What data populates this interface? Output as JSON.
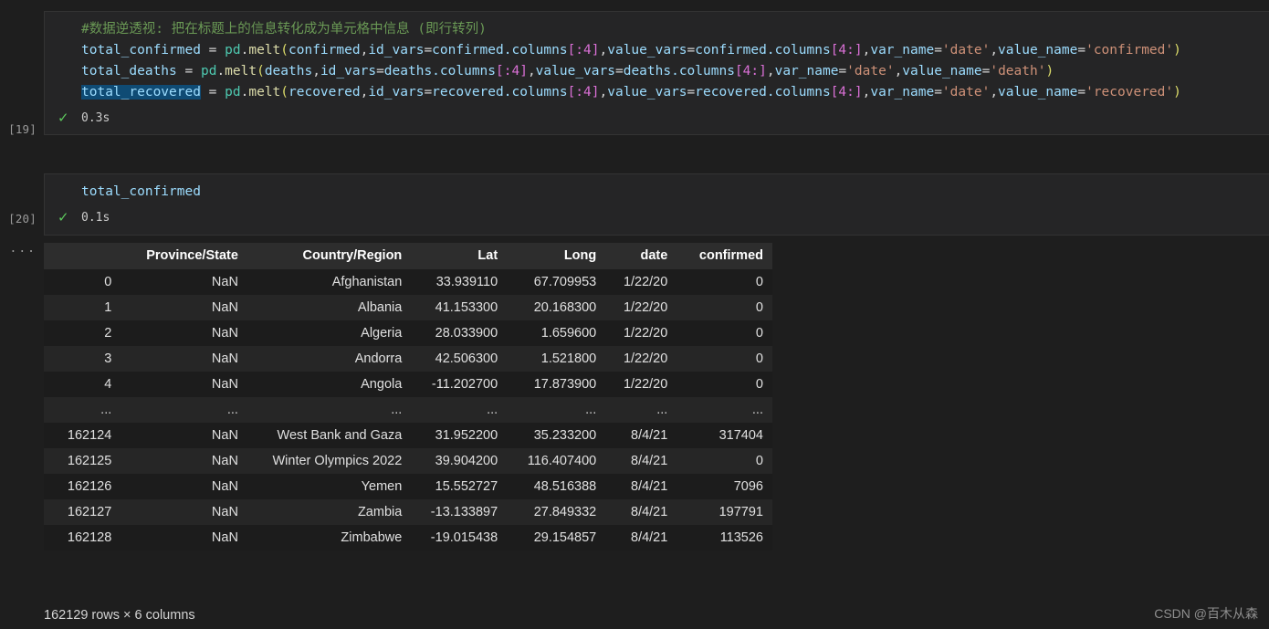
{
  "editor": {
    "background": "#1e1e1e",
    "cell_background": "#252526",
    "selection_color": "#0f4b74"
  },
  "cells": [
    {
      "label": "[19]",
      "status_icon": "check-icon",
      "runtime": "0.3s",
      "comment": "#数据逆透视: 把在标题上的信息转化成为单元格中信息 (即行转列)",
      "lines": [
        {
          "var": "total_confirmed",
          "selected": false,
          "rest_module": "pd",
          "rest_fn": "melt",
          "arg1": "confirmed",
          "arg2_name": "id_vars",
          "arg2_value": "confirmed.columns",
          "arg2_slice": "[:4]",
          "arg3_name": "value_vars",
          "arg3_value": "confirmed.columns",
          "arg3_slice": "[4:]",
          "arg4_name": "var_name",
          "arg4_value": "'date'",
          "arg5_name": "value_name",
          "arg5_value": "'confirmed'"
        },
        {
          "var": "total_deaths",
          "selected": false,
          "rest_module": "pd",
          "rest_fn": "melt",
          "arg1": "deaths",
          "arg2_name": "id_vars",
          "arg2_value": "deaths.columns",
          "arg2_slice": "[:4]",
          "arg3_name": "value_vars",
          "arg3_value": "deaths.columns",
          "arg3_slice": "[4:]",
          "arg4_name": "var_name",
          "arg4_value": "'date'",
          "arg5_name": "value_name",
          "arg5_value": "'death'"
        },
        {
          "var": "total_recovered",
          "selected": true,
          "rest_module": "pd",
          "rest_fn": "melt",
          "arg1": "recovered",
          "arg2_name": "id_vars",
          "arg2_value": "recovered.columns",
          "arg2_slice": "[:4]",
          "arg3_name": "value_vars",
          "arg3_value": "recovered.columns",
          "arg3_slice": "[4:]",
          "arg4_name": "var_name",
          "arg4_value": "'date'",
          "arg5_name": "value_name",
          "arg5_value": "'recovered'"
        }
      ]
    },
    {
      "label": "[20]",
      "status_icon": "check-icon",
      "runtime": "0.1s",
      "expression": "total_confirmed"
    }
  ],
  "output": {
    "gutter_more": "...",
    "columns": [
      "",
      "Province/State",
      "Country/Region",
      "Lat",
      "Long",
      "date",
      "confirmed"
    ],
    "rows": [
      [
        "0",
        "NaN",
        "Afghanistan",
        "33.939110",
        "67.709953",
        "1/22/20",
        "0"
      ],
      [
        "1",
        "NaN",
        "Albania",
        "41.153300",
        "20.168300",
        "1/22/20",
        "0"
      ],
      [
        "2",
        "NaN",
        "Algeria",
        "28.033900",
        "1.659600",
        "1/22/20",
        "0"
      ],
      [
        "3",
        "NaN",
        "Andorra",
        "42.506300",
        "1.521800",
        "1/22/20",
        "0"
      ],
      [
        "4",
        "NaN",
        "Angola",
        "-11.202700",
        "17.873900",
        "1/22/20",
        "0"
      ],
      [
        "...",
        "...",
        "...",
        "...",
        "...",
        "...",
        "..."
      ],
      [
        "162124",
        "NaN",
        "West Bank and Gaza",
        "31.952200",
        "35.233200",
        "8/4/21",
        "317404"
      ],
      [
        "162125",
        "NaN",
        "Winter Olympics 2022",
        "39.904200",
        "116.407400",
        "8/4/21",
        "0"
      ],
      [
        "162126",
        "NaN",
        "Yemen",
        "15.552727",
        "48.516388",
        "8/4/21",
        "7096"
      ],
      [
        "162127",
        "NaN",
        "Zambia",
        "-13.133897",
        "27.849332",
        "8/4/21",
        "197791"
      ],
      [
        "162128",
        "NaN",
        "Zimbabwe",
        "-19.015438",
        "29.154857",
        "8/4/21",
        "113526"
      ]
    ],
    "shape_note": "162129 rows × 6 columns"
  },
  "watermark": "CSDN @百木从森"
}
